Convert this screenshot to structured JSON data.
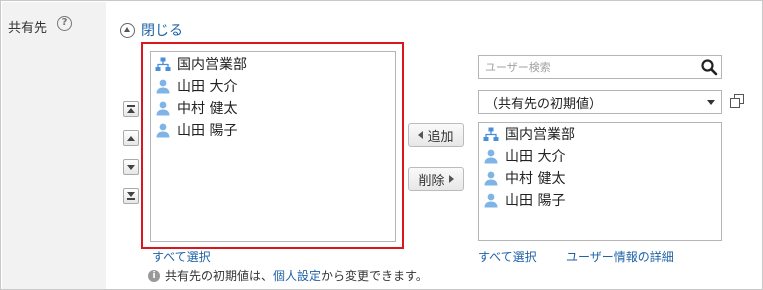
{
  "field": {
    "label": "共有先",
    "help_glyph": "?"
  },
  "toggle": {
    "label": "閉じる"
  },
  "order_buttons": [
    "move-top",
    "move-up",
    "move-down",
    "move-bottom"
  ],
  "left_list": {
    "items": [
      {
        "label": "国内営業部",
        "icon": "org-icon"
      },
      {
        "label": "山田 大介",
        "icon": "user-icon"
      },
      {
        "label": "中村 健太",
        "icon": "user-icon"
      },
      {
        "label": "山田 陽子",
        "icon": "user-icon"
      }
    ],
    "select_all": "すべて選択"
  },
  "actions": {
    "add": "追加",
    "remove": "削除"
  },
  "search": {
    "placeholder": "ユーザー検索"
  },
  "group_select": {
    "value": "（共有先の初期値）"
  },
  "right_list": {
    "items": [
      {
        "label": "国内営業部",
        "icon": "org-icon"
      },
      {
        "label": "山田 大介",
        "icon": "user-icon"
      },
      {
        "label": "中村 健太",
        "icon": "user-icon"
      },
      {
        "label": "山田 陽子",
        "icon": "user-icon"
      }
    ],
    "select_all": "すべて選択",
    "user_detail": "ユーザー情報の詳細"
  },
  "note": {
    "prefix": "共有先の初期値は、",
    "link": "個人設定",
    "suffix": "から変更できます。"
  },
  "colors": {
    "accent_link": "#1e62a8",
    "highlight_border": "#d9181e",
    "icon_blue": "#4a90d9"
  }
}
